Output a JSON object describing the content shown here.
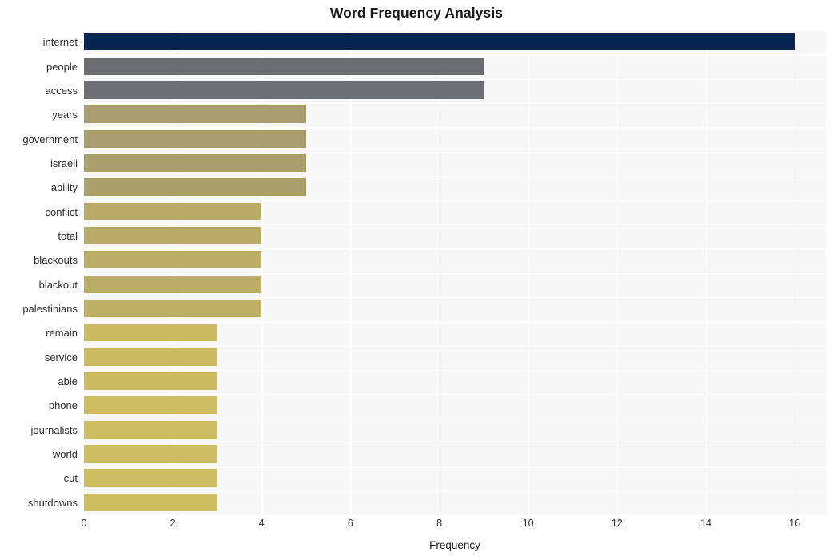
{
  "chart_data": {
    "type": "bar",
    "orientation": "horizontal",
    "title": "Word Frequency Analysis",
    "xlabel": "Frequency",
    "ylabel": "",
    "xlim": [
      0,
      16.7
    ],
    "xticks": [
      0,
      2,
      4,
      6,
      8,
      10,
      12,
      14,
      16
    ],
    "xtick_labels": [
      "0",
      "2",
      "4",
      "6",
      "8",
      "10",
      "12",
      "14",
      "16"
    ],
    "grid": true,
    "legend": false,
    "categories": [
      "internet",
      "people",
      "access",
      "years",
      "government",
      "israeli",
      "ability",
      "conflict",
      "total",
      "blackouts",
      "blackout",
      "palestinians",
      "remain",
      "service",
      "able",
      "phone",
      "journalists",
      "world",
      "cut",
      "shutdowns"
    ],
    "values": [
      16,
      9,
      9,
      5,
      5,
      5,
      5,
      4,
      4,
      4,
      4,
      4,
      3,
      3,
      3,
      3,
      3,
      3,
      3,
      3
    ],
    "bar_colors": [
      "#042550",
      "#6b6c70",
      "#6e6f73",
      "#a89d6e",
      "#a89d6e",
      "#aa9f6d",
      "#aa9f6d",
      "#b8ab67",
      "#b8ab67",
      "#bbad66",
      "#bbad66",
      "#bdaf65",
      "#cbba62",
      "#cbba62",
      "#cbba62",
      "#cdbc61",
      "#cdbc61",
      "#cdbc61",
      "#cdbc61",
      "#cfbe60"
    ],
    "plot_background": "#f7f7f7",
    "gridline_color": "#ffffff"
  }
}
